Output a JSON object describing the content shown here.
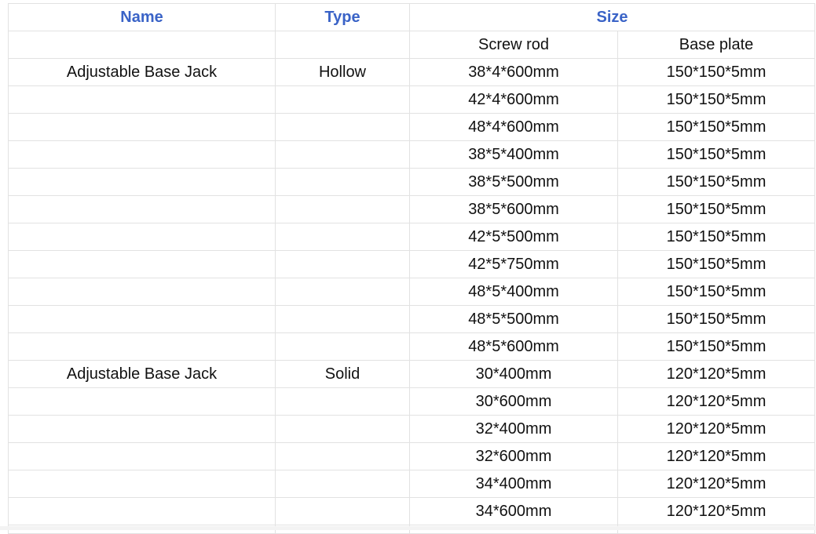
{
  "headers": {
    "name": "Name",
    "type": "Type",
    "size": "Size",
    "screw_rod": "Screw rod",
    "base_plate": "Base plate"
  },
  "rows": [
    {
      "name": "Adjustable Base Jack",
      "type": "Hollow",
      "screw_rod": "38*4*600mm",
      "base_plate": "150*150*5mm"
    },
    {
      "name": "",
      "type": "",
      "screw_rod": "42*4*600mm",
      "base_plate": "150*150*5mm"
    },
    {
      "name": "",
      "type": "",
      "screw_rod": "48*4*600mm",
      "base_plate": "150*150*5mm"
    },
    {
      "name": "",
      "type": "",
      "screw_rod": "38*5*400mm",
      "base_plate": "150*150*5mm"
    },
    {
      "name": "",
      "type": "",
      "screw_rod": "38*5*500mm",
      "base_plate": "150*150*5mm"
    },
    {
      "name": "",
      "type": "",
      "screw_rod": "38*5*600mm",
      "base_plate": "150*150*5mm"
    },
    {
      "name": "",
      "type": "",
      "screw_rod": "42*5*500mm",
      "base_plate": "150*150*5mm"
    },
    {
      "name": "",
      "type": "",
      "screw_rod": "42*5*750mm",
      "base_plate": "150*150*5mm"
    },
    {
      "name": "",
      "type": "",
      "screw_rod": "48*5*400mm",
      "base_plate": "150*150*5mm"
    },
    {
      "name": "",
      "type": "",
      "screw_rod": "48*5*500mm",
      "base_plate": "150*150*5mm"
    },
    {
      "name": "",
      "type": "",
      "screw_rod": "48*5*600mm",
      "base_plate": "150*150*5mm"
    },
    {
      "name": "Adjustable Base Jack",
      "type": "Solid",
      "screw_rod": "30*400mm",
      "base_plate": "120*120*5mm"
    },
    {
      "name": "",
      "type": "",
      "screw_rod": "30*600mm",
      "base_plate": "120*120*5mm"
    },
    {
      "name": "",
      "type": "",
      "screw_rod": "32*400mm",
      "base_plate": "120*120*5mm"
    },
    {
      "name": "",
      "type": "",
      "screw_rod": "32*600mm",
      "base_plate": "120*120*5mm"
    },
    {
      "name": "",
      "type": "",
      "screw_rod": "34*400mm",
      "base_plate": "120*120*5mm"
    },
    {
      "name": "",
      "type": "",
      "screw_rod": "34*600mm",
      "base_plate": "120*120*5mm"
    }
  ],
  "colors": {
    "header_text": "#3a63c7",
    "body_text": "#111111",
    "grid_line": "#e2e2e2"
  }
}
